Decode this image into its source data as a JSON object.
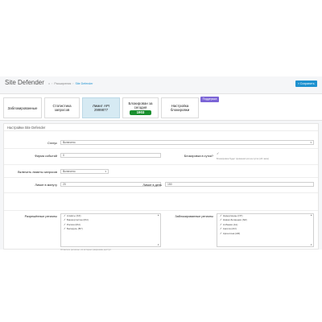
{
  "header": {
    "title": "Site Defender",
    "breadcrumbs": [
      "Расширения",
      "Site Defender"
    ],
    "save_label": "Сохранить"
  },
  "tabs": [
    {
      "label": "Заблокированные",
      "badge": ""
    },
    {
      "label": "Статистика запросов",
      "badge": ""
    },
    {
      "label": "Лимит API 2999877",
      "badge": ""
    },
    {
      "label": "Блокирован за сегодня",
      "badge": "1903"
    },
    {
      "label": "Настройка блокировки",
      "badge": ""
    }
  ],
  "support_label": "Поддержка",
  "settings": {
    "panel_title": "Настройки Site Defender",
    "status_label": "Статус",
    "status_value": "Включено",
    "events_label": "Фирма событий",
    "events_value": "0",
    "block_time_label": "Блокировка в сутки?",
    "block_time_checked": true,
    "block_time_hint": "Блокировка будет применяться на сутки (24 часа)",
    "limit_mode_label": "Включить лимиты запросов",
    "limit_mode_value": "Включено",
    "limit_minute_label": "Лимит в минуту",
    "limit_minute_value": "20",
    "limit_day_label": "Лимит в день",
    "limit_day_value": "150",
    "allowed_label": "Разрешённые регионы",
    "allowed_items": [
      "Алматы (KZ)",
      "Башкортостан (RU)",
      "Россия (RU)",
      "Беларусь (BY)"
    ],
    "allowed_hint": "Отметьте регионы, из которых разрешён доступ",
    "blocked_label": "Заблокированные регионы",
    "blocked_items": [
      "Нидерланды (NT)",
      "Новая Зеландия (NZ)",
      "Албания (AL)",
      "Ангола (AO)",
      "Аргентина (AR)"
    ]
  }
}
